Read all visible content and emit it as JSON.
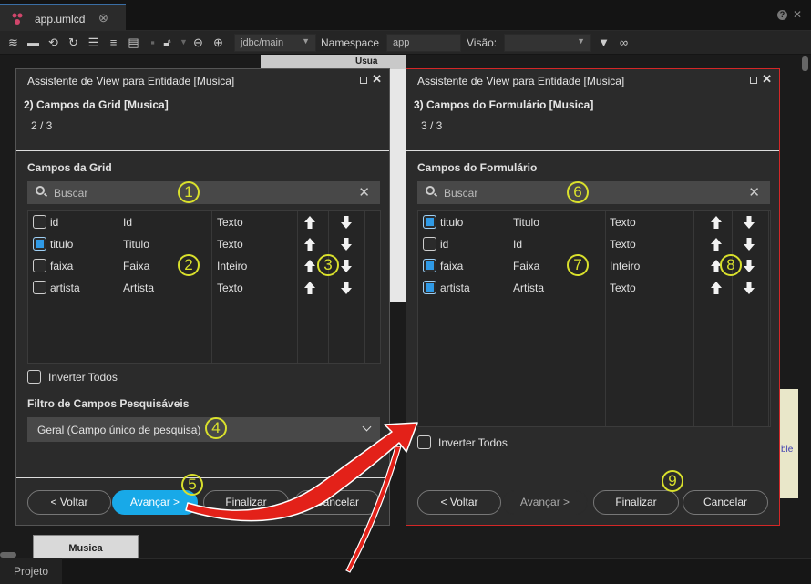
{
  "window": {
    "tab_label": "app.umlcd",
    "tab_close": "⊗",
    "help": "?",
    "close_all": "✕"
  },
  "toolbar": {
    "connection_value": "jdbc/main",
    "namespace_label": "Namespace",
    "namespace_value": "app",
    "view_label": "Visão:",
    "view_value": ""
  },
  "background": {
    "entity_label": "Musica",
    "entity_header": "Usua",
    "yellow_text": "ble",
    "project_tab": "Projeto"
  },
  "dialog_grid": {
    "title": "Assistente de View para Entidade [Musica]",
    "step_title": "2) Campos da Grid [Musica]",
    "step_count": "2 / 3",
    "section_title": "Campos da Grid",
    "search_placeholder": "Buscar",
    "rows": [
      {
        "name": "id",
        "label": "Id",
        "type": "Texto",
        "checked": false
      },
      {
        "name": "titulo",
        "label": "Titulo",
        "type": "Texto",
        "checked": true
      },
      {
        "name": "faixa",
        "label": "Faixa",
        "type": "Inteiro",
        "checked": false
      },
      {
        "name": "artista",
        "label": "Artista",
        "type": "Texto",
        "checked": false
      }
    ],
    "invert_label": "Inverter Todos",
    "filter_title": "Filtro de Campos Pesquisáveis",
    "filter_value": "Geral (Campo único de pesquisa)",
    "buttons": {
      "back": "< Voltar",
      "next": "Avançar >",
      "finish": "Finalizar",
      "cancel": "Cancelar"
    }
  },
  "dialog_form": {
    "title": "Assistente de View para Entidade [Musica]",
    "step_title": "3) Campos do Formulário [Musica]",
    "step_count": "3 / 3",
    "section_title": "Campos do Formulário",
    "search_placeholder": "Buscar",
    "rows": [
      {
        "name": "titulo",
        "label": "Titulo",
        "type": "Texto",
        "checked": true
      },
      {
        "name": "id",
        "label": "Id",
        "type": "Texto",
        "checked": false
      },
      {
        "name": "faixa",
        "label": "Faixa",
        "type": "Inteiro",
        "checked": true
      },
      {
        "name": "artista",
        "label": "Artista",
        "type": "Texto",
        "checked": true
      }
    ],
    "invert_label": "Inverter Todos",
    "buttons": {
      "back": "< Voltar",
      "next": "Avançar >",
      "finish": "Finalizar",
      "cancel": "Cancelar"
    }
  },
  "annotations": {
    "m1": "1",
    "m2": "2",
    "m3": "3",
    "m4": "4",
    "m5": "5",
    "m6": "6",
    "m7": "7",
    "m8": "8",
    "m9": "9"
  },
  "colors": {
    "accent": "#18a9e8",
    "highlight_border": "#d42727",
    "annotation": "#d9e02c",
    "arrow": "#e32119"
  }
}
